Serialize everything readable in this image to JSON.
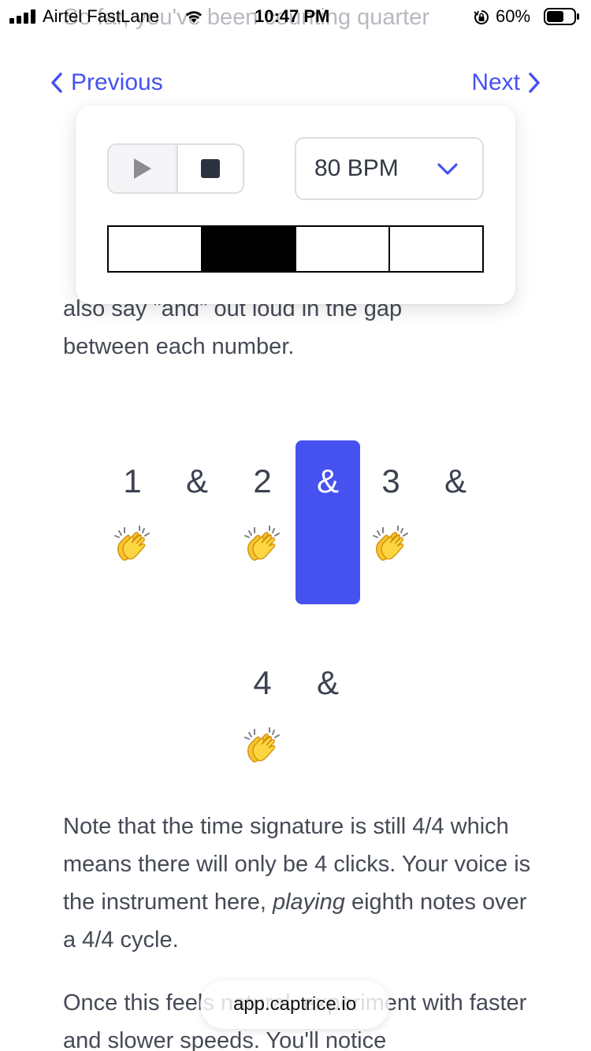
{
  "status_bar": {
    "carrier": "Airtel FastLane",
    "time": "10:47 PM",
    "battery": "60%"
  },
  "behind_text": "So far, you've been counting quarter",
  "nav": {
    "previous": "Previous",
    "next": "Next"
  },
  "metronome": {
    "tempo": "80 BPM",
    "beats": 4,
    "active_beat": 2,
    "play_icon": "play-icon",
    "stop_icon": "stop-icon"
  },
  "paragraph_1": {
    "line_1": "also say \"and\" out loud in the gap",
    "line_2": "between each number."
  },
  "counting": [
    {
      "label": "1",
      "clap": true,
      "active": false
    },
    {
      "label": "&",
      "clap": false,
      "active": false
    },
    {
      "label": "2",
      "clap": true,
      "active": false
    },
    {
      "label": "&",
      "clap": false,
      "active": true
    },
    {
      "label": "3",
      "clap": true,
      "active": false
    },
    {
      "label": "&",
      "clap": false,
      "active": false
    },
    {
      "label": "4",
      "clap": true,
      "active": false
    },
    {
      "label": "&",
      "clap": false,
      "active": false
    }
  ],
  "paragraph_2": {
    "before_em": "Note that the time signature is still 4/4 which means there will only be 4 clicks. Your voice is the instrument here, ",
    "em": "playing",
    "after_em": " eighth notes over a 4/4 cycle."
  },
  "paragraph_3": "Once this feels natural, experiment with faster and slower speeds. You'll notice",
  "url": "app.captrice.io",
  "colors": {
    "accent": "#4552f0",
    "text": "#454a55"
  }
}
